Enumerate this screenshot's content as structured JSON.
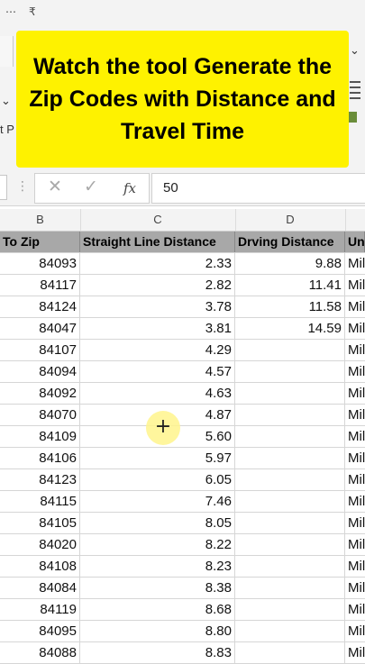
{
  "ribbon": {
    "qat_glyph_1": "⋯",
    "qat_glyph_2": "₹",
    "left_fragment": "t P",
    "left_caret": "⌄",
    "right_caret": "⌄"
  },
  "banner": {
    "text": "Watch the tool Generate the Zip Codes with Distance and Travel Time"
  },
  "formula_bar": {
    "cancel_glyph": "✕",
    "enter_glyph": "✓",
    "fx_label": "fx",
    "value": "50"
  },
  "columns": [
    "B",
    "C",
    "D"
  ],
  "table": {
    "headers": [
      "To Zip",
      "Straight Line Distance",
      "Drving Distance",
      "Un"
    ],
    "rows": [
      [
        "84093",
        "2.33",
        "9.88",
        "Mil"
      ],
      [
        "84117",
        "2.82",
        "11.41",
        "Mil"
      ],
      [
        "84124",
        "3.78",
        "11.58",
        "Mil"
      ],
      [
        "84047",
        "3.81",
        "14.59",
        "Mil"
      ],
      [
        "84107",
        "4.29",
        "",
        "Mil"
      ],
      [
        "84094",
        "4.57",
        "",
        "Mil"
      ],
      [
        "84092",
        "4.63",
        "",
        "Mil"
      ],
      [
        "84070",
        "4.87",
        "",
        "Mil"
      ],
      [
        "84109",
        "5.60",
        "",
        "Mil"
      ],
      [
        "84106",
        "5.97",
        "",
        "Mil"
      ],
      [
        "84123",
        "6.05",
        "",
        "Mil"
      ],
      [
        "84115",
        "7.46",
        "",
        "Mil"
      ],
      [
        "84105",
        "8.05",
        "",
        "Mil"
      ],
      [
        "84020",
        "8.22",
        "",
        "Mil"
      ],
      [
        "84108",
        "8.23",
        "",
        "Mil"
      ],
      [
        "84084",
        "8.38",
        "",
        "Mil"
      ],
      [
        "84119",
        "8.68",
        "",
        "Mil"
      ],
      [
        "84095",
        "8.80",
        "",
        "Mil"
      ],
      [
        "84088",
        "8.83",
        "",
        "Mil"
      ]
    ]
  },
  "cursor": {
    "glyph": "+"
  },
  "colors": {
    "banner": "#fef200",
    "header_fill": "#a8a8a8",
    "ribbon_bg": "#f3f3f3"
  }
}
